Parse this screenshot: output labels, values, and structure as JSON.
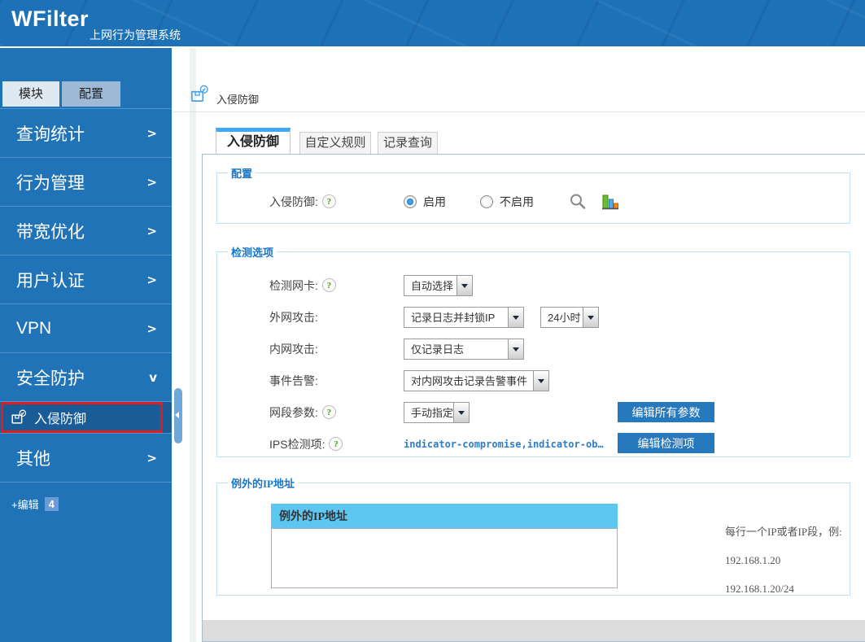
{
  "header": {
    "logo": "WFilter",
    "subtitle": "上网行为管理系统"
  },
  "icons": {
    "help": "?"
  },
  "sidebar": {
    "tabs": [
      {
        "label": "模块",
        "active": true
      },
      {
        "label": "配置",
        "active": false
      }
    ],
    "menu": [
      {
        "label": "查询统计",
        "chevron": ">"
      },
      {
        "label": "行为管理",
        "chevron": ">"
      },
      {
        "label": "带宽优化",
        "chevron": ">"
      },
      {
        "label": "用户认证",
        "chevron": ">"
      },
      {
        "label": "VPN",
        "chevron": ">"
      },
      {
        "label": "安全防护",
        "chevron": "v"
      }
    ],
    "submenu": {
      "label": "入侵防御"
    },
    "menu_after": [
      {
        "label": "其他",
        "chevron": ">"
      }
    ],
    "edit": {
      "label": "+编辑",
      "badge": "4"
    }
  },
  "breadcrumb": {
    "title": "入侵防御"
  },
  "content_tabs": [
    {
      "label": "入侵防御",
      "active": true
    },
    {
      "label": "自定义规则",
      "active": false
    },
    {
      "label": "记录查询",
      "active": false
    }
  ],
  "sections": {
    "config": {
      "legend": "配置",
      "label": "入侵防御:",
      "enabled_option": "启用",
      "disabled_option": "不启用",
      "enabled": true
    },
    "detect": {
      "legend": "检测选项",
      "nic_label": "检测网卡:",
      "nic_value": "自动选择",
      "wan_label": "外网攻击:",
      "wan_value": "记录日志并封锁IP",
      "wan_duration": "24小时",
      "lan_label": "内网攻击:",
      "lan_value": "仅记录日志",
      "alert_label": "事件告警:",
      "alert_value": "对内网攻击记录告警事件",
      "segment_label": "网段参数:",
      "segment_value": "手动指定",
      "segment_button": "编辑所有参数",
      "ips_label": "IPS检测项:",
      "ips_value": "indicator-compromise,indicator-ob…",
      "ips_button": "编辑检测项"
    },
    "exceptions": {
      "legend": "例外的IP地址",
      "table_header": "例外的IP地址",
      "textarea_value": "",
      "hint_title": "每行一个IP或者IP段，例:",
      "hint_examples": [
        "192.168.1.20",
        "192.168.1.20/24"
      ]
    }
  },
  "colors": {
    "primary_blue": "#1d71b7",
    "submenu_active_blue": "#1a5c98",
    "tab_strip_blue": "#3fa9f5",
    "button_blue": "#2779bd",
    "table_header_blue": "#5ec7f1",
    "highlight_red": "#e21b1b",
    "footer_gray": "#dcdcdc"
  }
}
